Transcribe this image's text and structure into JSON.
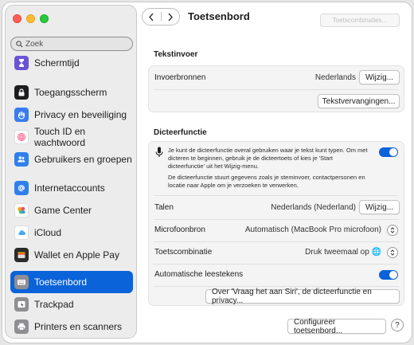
{
  "window": {
    "title": "Toetsenbord"
  },
  "toolbar": {
    "right_button": "Toetscombinaties..."
  },
  "search": {
    "placeholder": "Zoek"
  },
  "sidebar": {
    "items": [
      {
        "label": "Schermtijd",
        "icon": "hourglass-icon",
        "color": "#6b53d6"
      },
      {
        "label": "Toegangsscherm",
        "icon": "lock-icon",
        "color": "#1d1d1f"
      },
      {
        "label": "Privacy en beveiliging",
        "icon": "hand-icon",
        "color": "#3a7cf0"
      },
      {
        "label": "Touch ID en wachtwoord",
        "icon": "fingerprint-icon",
        "color": "#ffffff"
      },
      {
        "label": "Gebruikers en groepen",
        "icon": "users-icon",
        "color": "#2f80ed"
      },
      {
        "label": "Internetaccounts",
        "icon": "at-icon",
        "color": "#2f80ed"
      },
      {
        "label": "Game Center",
        "icon": "game-center-icon",
        "color": "#ffffff"
      },
      {
        "label": "iCloud",
        "icon": "cloud-icon",
        "color": "#ffffff"
      },
      {
        "label": "Wallet en Apple Pay",
        "icon": "wallet-icon",
        "color": "#2b2b2b"
      },
      {
        "label": "Toetsenbord",
        "icon": "keyboard-icon",
        "color": "#8e8e93"
      },
      {
        "label": "Trackpad",
        "icon": "trackpad-icon",
        "color": "#8e8e93"
      },
      {
        "label": "Printers en scanners",
        "icon": "printer-icon",
        "color": "#8e8e93"
      }
    ],
    "active_index": 9
  },
  "tekstinvoer": {
    "title": "Tekstinvoer",
    "invoerbronnen_label": "Invoerbronnen",
    "invoerbronnen_value": "Nederlands",
    "wijzig_label": "Wijzig...",
    "tekstvervangingen_label": "Tekstvervangingen..."
  },
  "dicteer": {
    "title": "Dicteerfunctie",
    "desc1": "Je kunt de dicteerfunctie overal gebruiken waar je tekst kunt typen. Om met dicteren te beginnen, gebruik je de dicteertoets of kies je 'Start dicteerfunctie' uit het Wijzig-menu.",
    "desc2": "De dicteerfunctie stuurt gegevens zoals je steminvoer, contactpersonen en locatie naar Apple om je verzoeken te verwerken.",
    "toggle_on": true,
    "talen_label": "Talen",
    "talen_value": "Nederlands (Nederland)",
    "talen_button": "Wijzig...",
    "micro_label": "Microfoonbron",
    "micro_value": "Automatisch (MacBook Pro microfoon)",
    "toets_label": "Toetscombinatie",
    "toets_value": "Druk tweemaal op 🌐",
    "auto_label": "Automatische leestekens",
    "auto_on": true,
    "siri_button": "Over 'Vraag het aan Siri', de dicteerfunctie en privacy..."
  },
  "footer": {
    "configureer_button": "Configureer toetsenbord...",
    "help": "?"
  }
}
